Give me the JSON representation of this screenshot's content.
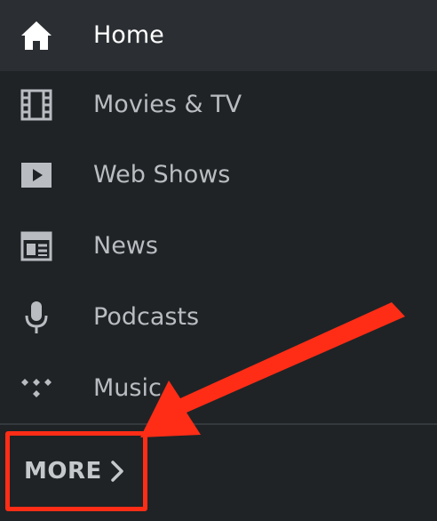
{
  "nav": {
    "items": [
      {
        "label": "Home",
        "icon": "home-icon",
        "active": true
      },
      {
        "label": "Movies & TV",
        "icon": "film-icon",
        "active": false
      },
      {
        "label": "Web Shows",
        "icon": "play-icon",
        "active": false
      },
      {
        "label": "News",
        "icon": "newspaper-icon",
        "active": false
      },
      {
        "label": "Podcasts",
        "icon": "microphone-icon",
        "active": false
      },
      {
        "label": "Music",
        "icon": "tidal-icon",
        "active": false
      }
    ],
    "more_label": "MORE"
  },
  "colors": {
    "background": "#1f2326",
    "active_background": "#2b2f33",
    "text": "#b9bdc1",
    "active_text": "#ffffff",
    "annotation": "#ff2d16"
  }
}
